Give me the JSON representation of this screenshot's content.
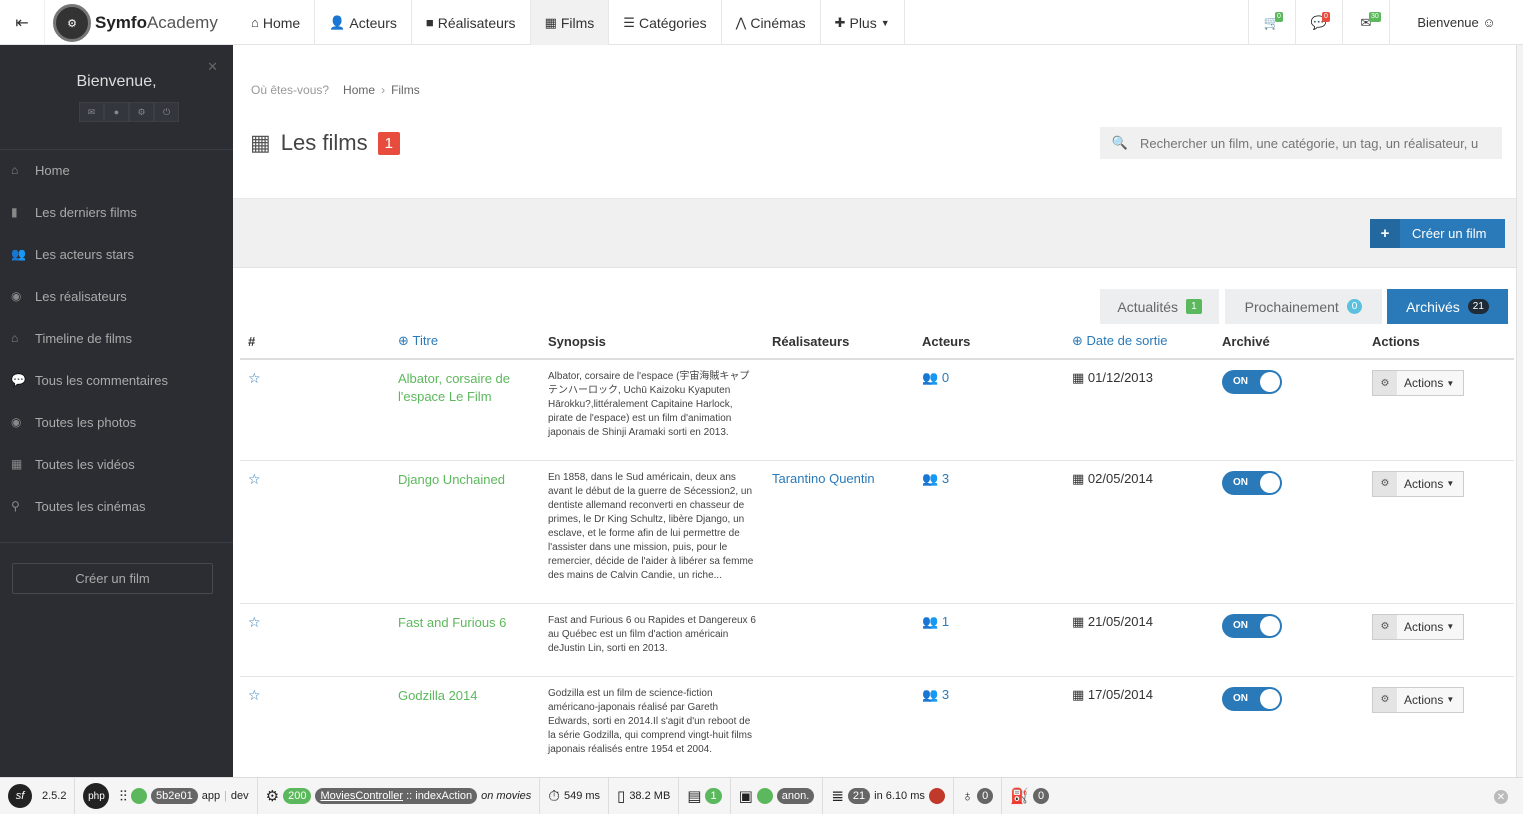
{
  "topbar": {
    "brand_bold": "Symfo",
    "brand_light": "Academy",
    "nav": [
      {
        "label": "Home",
        "icon": "home-icon",
        "glyph": "⌂"
      },
      {
        "label": "Acteurs",
        "icon": "user-icon",
        "glyph": "👤"
      },
      {
        "label": "Réalisateurs",
        "icon": "video-camera-icon",
        "glyph": "■"
      },
      {
        "label": "Films",
        "icon": "film-icon",
        "glyph": "▦"
      },
      {
        "label": "Catégories",
        "icon": "list-icon",
        "glyph": "☰"
      },
      {
        "label": "Cinémas",
        "icon": "road-icon",
        "glyph": "⋀"
      },
      {
        "label": "Plus",
        "icon": "plus-icon",
        "glyph": "✚"
      }
    ],
    "cart_count": "0",
    "comments_count": "0",
    "mail_count": "30",
    "welcome": "Bienvenue ☺",
    "accent_green": "#5cb85c",
    "accent_red": "#e74c3c"
  },
  "sidebar": {
    "welcome": "Bienvenue,",
    "menu": [
      {
        "label": "Home",
        "icon": "home-icon"
      },
      {
        "label": "Les derniers films",
        "icon": "bookmark-icon"
      },
      {
        "label": "Les acteurs stars",
        "icon": "users-icon"
      },
      {
        "label": "Les réalisateurs",
        "icon": "camera-icon"
      },
      {
        "label": "Timeline de films",
        "icon": "home-icon"
      },
      {
        "label": "Tous les commentaires",
        "icon": "comments-icon"
      },
      {
        "label": "Toutes les photos",
        "icon": "camera-icon"
      },
      {
        "label": "Toutes les vidéos",
        "icon": "film-icon"
      },
      {
        "label": "Toutes les cinémas",
        "icon": "map-marker-icon"
      }
    ],
    "create_button": "Créer un film"
  },
  "breadcrumb": {
    "prefix": "Où êtes-vous?",
    "home": "Home",
    "current": "Films"
  },
  "page": {
    "title": "Les films",
    "count": "1",
    "search_placeholder": "Rechercher un film, une catégorie, un tag, un réalisateur, u",
    "create_button": "Créer un film",
    "primary_color": "#2a7ab9"
  },
  "tabs": [
    {
      "label": "Actualités",
      "badge": "1"
    },
    {
      "label": "Prochainement",
      "badge": "0"
    },
    {
      "label": "Archivés",
      "badge": "21"
    }
  ],
  "table": {
    "headers": [
      "#",
      "Titre",
      "Synopsis",
      "Réalisateurs",
      "Acteurs",
      "Date de sortie",
      "Archivé",
      "Actions"
    ],
    "rows": [
      {
        "title": "Albator, corsaire de l'espace Le Film",
        "synopsis": "Albator, corsaire de l'espace (宇宙海賊キャプテンハーロック, Uchū Kaizoku Kyaputen Hārokku?,littéralement Capitaine Harlock, pirate de l'espace) est un film d'animation japonais de Shinji Aramaki sorti en 2013.",
        "director": "",
        "actors": "0",
        "date": "01/12/2013",
        "archived": "ON",
        "actions": "Actions"
      },
      {
        "title": "Django Unchained",
        "synopsis": "En 1858, dans le Sud américain, deux ans avant le début de la guerre de Sécession2, un dentiste allemand reconverti en chasseur de primes, le Dr King Schultz, libère Django, un esclave, et le forme afin de lui permettre de l'assister dans une mission, puis, pour le remercier, décide de l'aider à libérer sa femme des mains de Calvin Candie, un riche...",
        "director": "Tarantino Quentin",
        "actors": "3",
        "date": "02/05/2014",
        "archived": "ON",
        "actions": "Actions"
      },
      {
        "title": "Fast and Furious 6",
        "synopsis": "Fast and Furious 6 ou Rapides et Dangereux 6 au Québec est un film d'action américain deJustin Lin, sorti en 2013.",
        "director": "",
        "actors": "1",
        "date": "21/05/2014",
        "archived": "ON",
        "actions": "Actions"
      },
      {
        "title": "Godzilla 2014",
        "synopsis": "Godzilla est un film de science-fiction américano-japonais réalisé par Gareth Edwards, sorti en 2014.Il s'agit d'un reboot de la série Godzilla, qui comprend vingt-huit films japonais réalisés entre 1954 et 2004.",
        "director": "",
        "actors": "3",
        "date": "17/05/2014",
        "archived": "ON",
        "actions": "Actions"
      }
    ]
  },
  "debugbar": {
    "sf_version": "2.5.2",
    "token": "5b2e01",
    "app": "app",
    "env": "dev",
    "status": "200",
    "controller": "MoviesController",
    "action": "indexAction",
    "route": "on movies",
    "time": "549 ms",
    "memory": "38.2 MB",
    "logs": "1",
    "user": "anon.",
    "queries": "21",
    "queries_time": "in 6.10 ms",
    "twig": "0",
    "cache": "0"
  }
}
